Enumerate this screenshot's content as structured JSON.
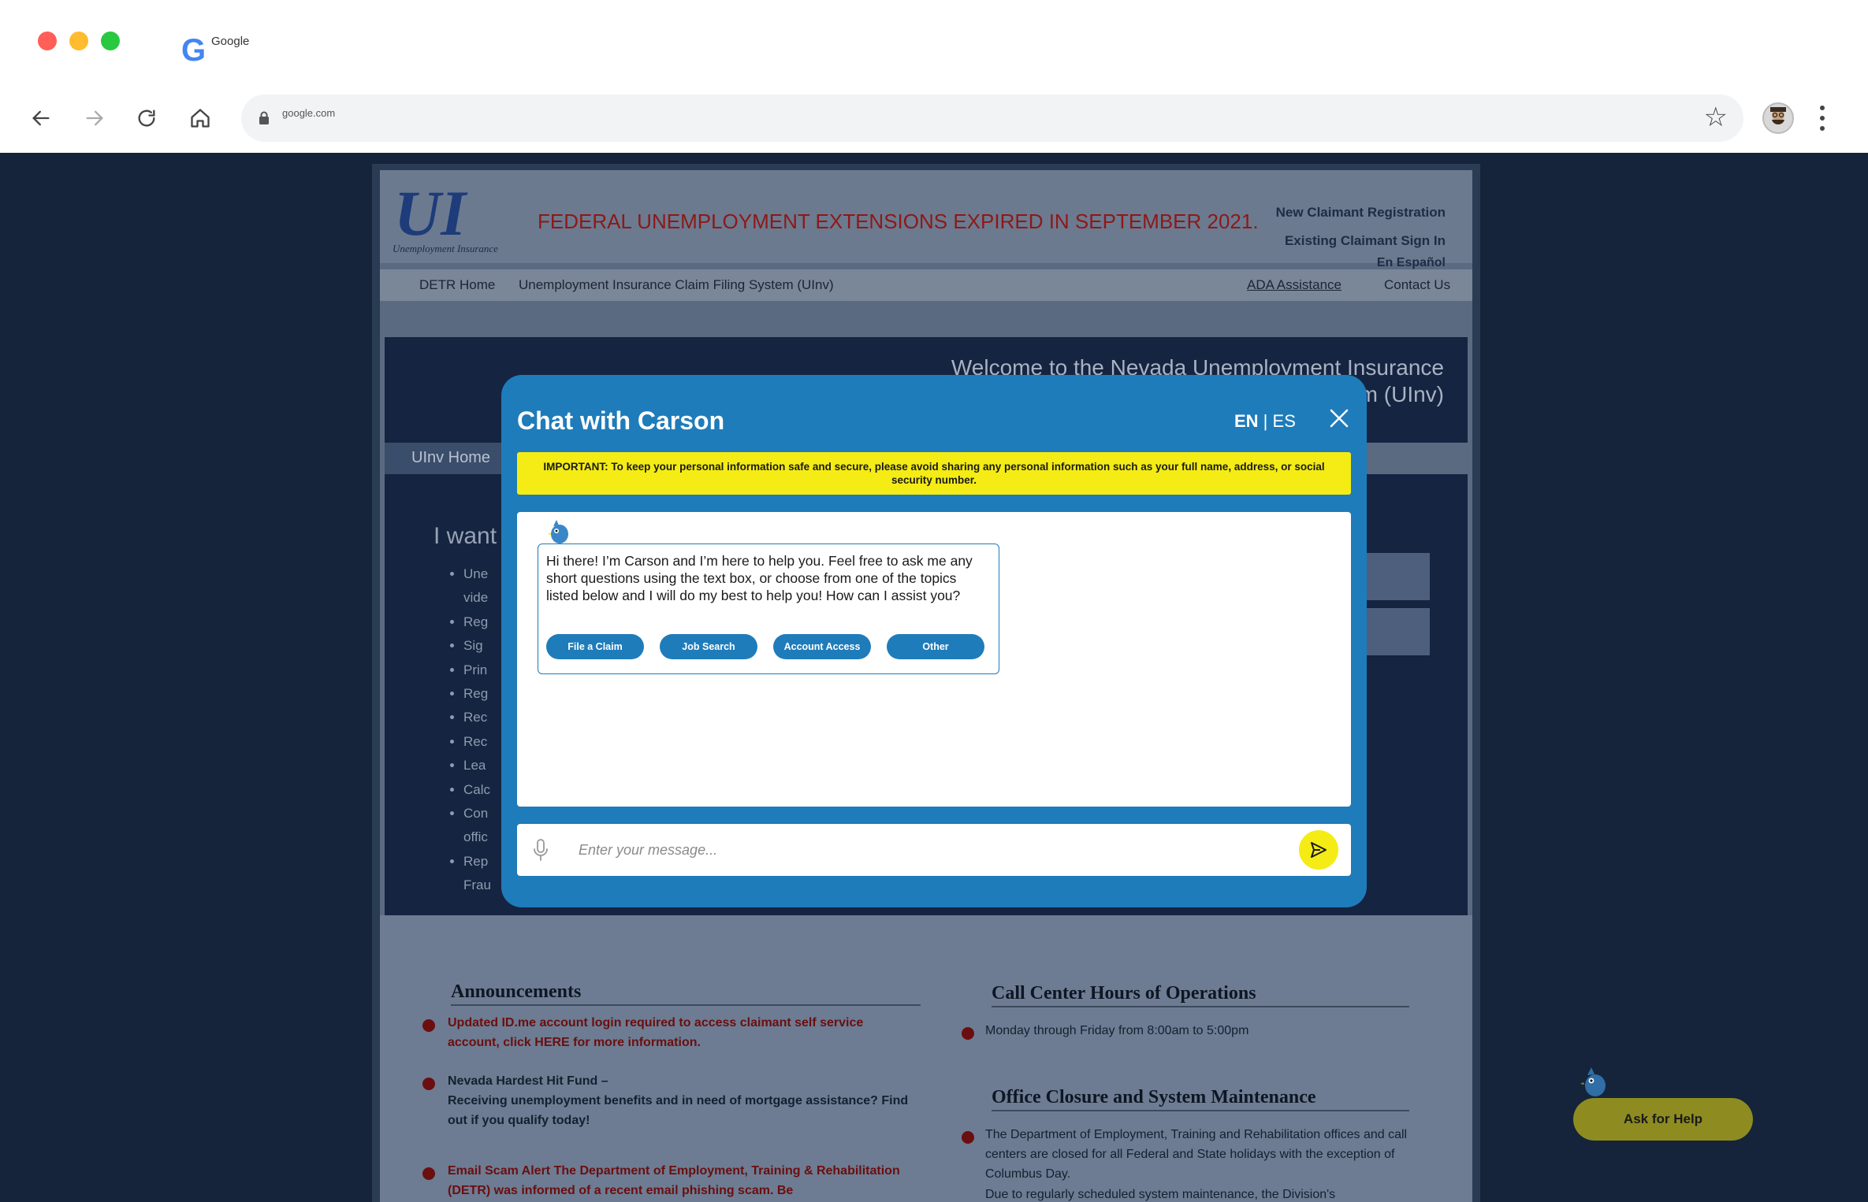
{
  "browser": {
    "tab_title": "Google",
    "url": "google.com"
  },
  "site": {
    "logo_text": "UI",
    "logo_subtitle": "Unemployment Insurance",
    "banner": "FEDERAL UNEMPLOYMENT EXTENSIONS EXPIRED IN SEPTEMBER 2021.",
    "header_links": {
      "new_claimant": "New Claimant Registration",
      "existing_claimant": "Existing Claimant Sign In",
      "espanol": "En Español"
    },
    "nav": {
      "detr_home": "DETR Home",
      "system": "Unemployment Insurance Claim Filing System (UInv)",
      "ada": "ADA Assistance",
      "contact": "Contact Us"
    },
    "hero_text_line1": "Welcome to the Nevada Unemployment Insurance",
    "hero_text_line2": "m (UInv)",
    "tab": "UInv Home",
    "main_heading": "I want",
    "list_items": [
      "Une",
      "vide",
      "Reg",
      "Sig",
      "Prin",
      "Reg",
      "Rec",
      "Rec",
      "Lea",
      "Calc",
      "Con",
      "offic",
      "Rep",
      "Frau"
    ],
    "announcements": {
      "title": "Announcements",
      "item1": "Updated ID.me account login required to access claimant self service account, click HERE for more information.",
      "item2_title": "Nevada Hardest Hit Fund –",
      "item2_body": "Receiving unemployment benefits and in need of mortgage assistance? Find out if you qualify today!",
      "item3": "Email Scam Alert The Department of Employment, Training & Rehabilitation (DETR) was informed of a recent email phishing scam. Be"
    },
    "call_center": {
      "title": "Call Center Hours of Operations",
      "hours": "Monday through Friday from 8:00am to 5:00pm"
    },
    "office_closure": {
      "title": "Office Closure and System Maintenance",
      "text": "The Department of Employment, Training and Rehabilitation offices and call centers are closed for all Federal and State holidays with the exception of Columbus Day.",
      "text2": "Due to regularly scheduled system maintenance, the Division's"
    }
  },
  "chat": {
    "title": "Chat with Carson",
    "lang_en": "EN",
    "lang_sep": " | ",
    "lang_es": "ES",
    "notice": "IMPORTANT: To keep your personal information safe and secure, please avoid sharing any personal information such as your full name, address, or social security number.",
    "greeting": "Hi there! I’m Carson and I’m here to help you.  Feel free to ask me any short questions using the text box, or choose from one of the topics listed below and I will do my best to help you! How can I assist you?",
    "chips": [
      "File a Claim",
      "Job Search",
      "Account Access",
      "Other"
    ],
    "input_placeholder": "Enter your message...",
    "accent_color": "#1f7cba",
    "highlight_color": "#f4ec14"
  },
  "help_button": "Ask for Help"
}
